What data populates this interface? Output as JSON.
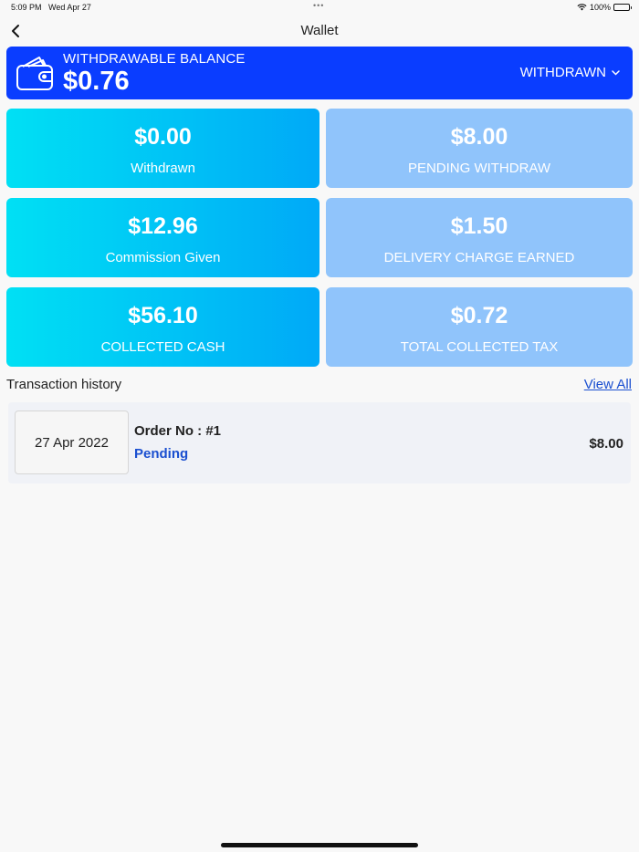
{
  "status_bar": {
    "time": "5:09 PM",
    "date": "Wed Apr 27",
    "dots": "•••",
    "battery": "100%"
  },
  "nav": {
    "title": "Wallet"
  },
  "balance": {
    "label": "WITHDRAWABLE BALANCE",
    "value": "$0.76",
    "withdrawn_button": "WITHDRAWN"
  },
  "stats": [
    {
      "value": "$0.00",
      "label": "Withdrawn"
    },
    {
      "value": "$8.00",
      "label": "PENDING WITHDRAW"
    },
    {
      "value": "$12.96",
      "label": "Commission Given"
    },
    {
      "value": "$1.50",
      "label": "DELIVERY CHARGE EARNED"
    },
    {
      "value": "$56.10",
      "label": "COLLECTED CASH"
    },
    {
      "value": "$0.72",
      "label": "TOTAL COLLECTED TAX"
    }
  ],
  "transactions": {
    "title": "Transaction history",
    "view_all": "View All",
    "items": [
      {
        "date": "27 Apr 2022",
        "order": "Order No : #1",
        "status": "Pending",
        "amount": "$8.00"
      }
    ]
  },
  "colors": {
    "banner": "#0a3dff",
    "card_cyan_start": "#00e0f4",
    "card_cyan_end": "#00a9f7",
    "card_light": "#90c4fb",
    "link": "#1a4fd0"
  }
}
